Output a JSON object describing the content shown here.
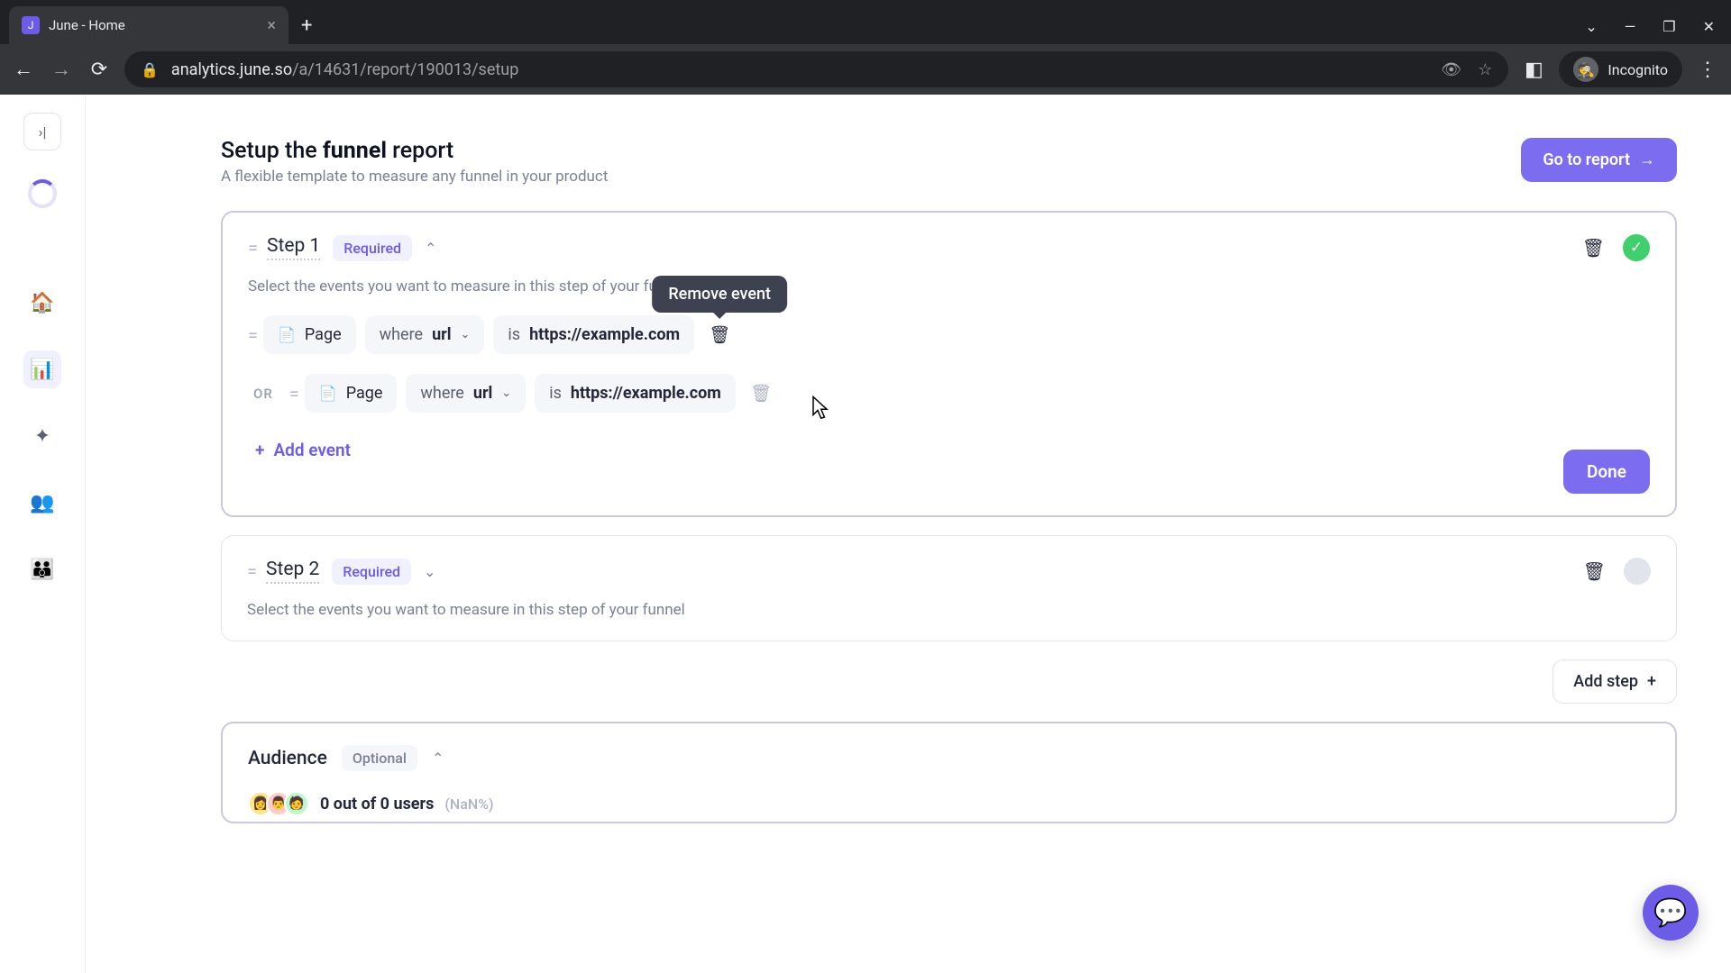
{
  "browser": {
    "tab_title": "June - Home",
    "url_host": "analytics.june.so",
    "url_path": "/a/14631/report/190013/setup",
    "incognito": "Incognito"
  },
  "page": {
    "title_pre": "Setup the ",
    "title_bold": "funnel",
    "title_post": " report",
    "subtitle": "A flexible template to measure any funnel in your product",
    "go_report": "Go to report"
  },
  "step1": {
    "name": "Step 1",
    "required": "Required",
    "desc": "Select the events you want to measure in this step of your funnel",
    "events": [
      {
        "type": "Page",
        "where": "where ",
        "field": "url",
        "is": "is ",
        "value": "https://example.com"
      },
      {
        "or": "OR",
        "type": "Page",
        "where": "where ",
        "field": "url",
        "is": "is ",
        "value": "https://example.com"
      }
    ],
    "remove_tooltip": "Remove event",
    "add_event": "Add event",
    "done": "Done"
  },
  "step2": {
    "name": "Step 2",
    "required": "Required",
    "desc": "Select the events you want to measure in this step of your funnel"
  },
  "add_step": "Add step",
  "audience": {
    "title": "Audience",
    "optional": "Optional",
    "count": "0 out of 0 users",
    "pct": "(NaN%)"
  }
}
